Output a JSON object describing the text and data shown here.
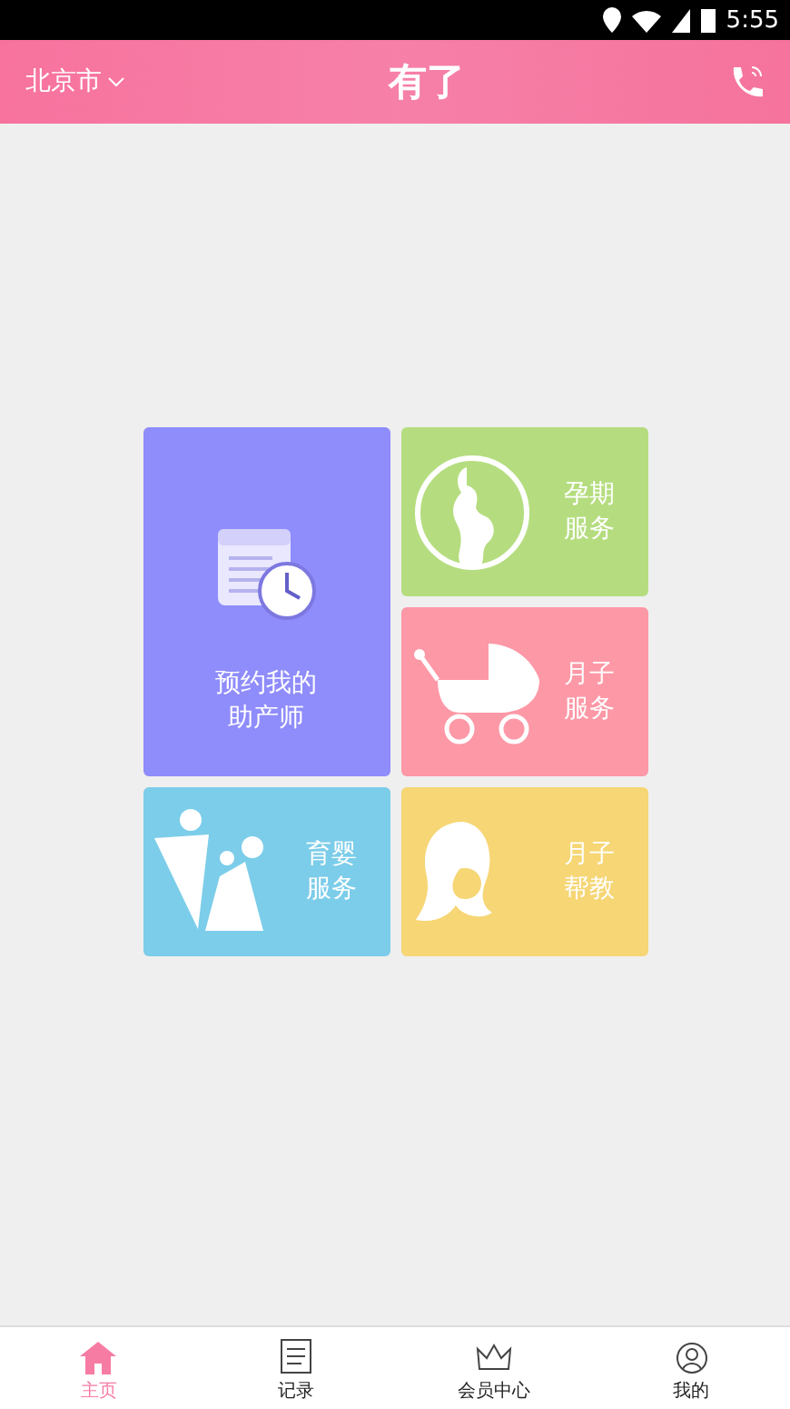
{
  "status_bar": {
    "time": "5:55"
  },
  "header": {
    "city": "北京市",
    "logo": "有了"
  },
  "tiles": [
    {
      "kind": "calendar",
      "lines": [
        "预约我的",
        "助产师"
      ],
      "color": "#8f8cfb"
    },
    {
      "kind": "pregnant",
      "lines": [
        "孕期",
        "服务"
      ],
      "color": "#b5dd7f"
    },
    {
      "kind": "stroller",
      "lines": [
        "月子",
        "服务"
      ],
      "color": "#fd98a6"
    },
    {
      "kind": "family",
      "lines": [
        "育婴",
        "服务"
      ],
      "color": "#7ccde9"
    },
    {
      "kind": "mother",
      "lines": [
        "月子",
        "帮教"
      ],
      "color": "#f6d675"
    }
  ],
  "nav": [
    {
      "kind": "home",
      "label": "主页",
      "selected": true
    },
    {
      "kind": "record",
      "label": "记录",
      "selected": false
    },
    {
      "kind": "member",
      "label": "会员中心",
      "selected": false
    },
    {
      "kind": "me",
      "label": "我的",
      "selected": false
    }
  ]
}
